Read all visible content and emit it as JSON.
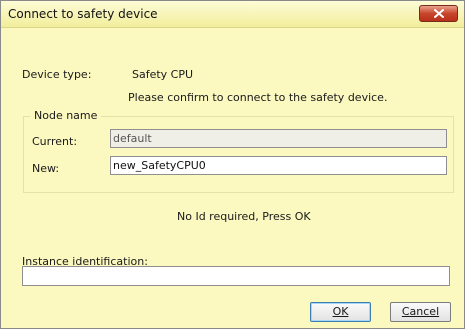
{
  "window": {
    "title": "Connect to safety device"
  },
  "device": {
    "type_label": "Device type:",
    "type_value": "Safety CPU",
    "confirm_message": "Please confirm to connect to the safety device."
  },
  "node_name": {
    "legend": "Node name",
    "current_label": "Current:",
    "current_value": "default",
    "new_label": "New:",
    "new_value": "new_SafetyCPU0"
  },
  "status_message": "No Id required, Press OK",
  "instance": {
    "label": "Instance identification:",
    "value": ""
  },
  "buttons": {
    "ok_label": "OK",
    "cancel_label": "Cancel"
  },
  "colors": {
    "dialog_background": "#fbf8c0",
    "close_button": "#c8452b"
  },
  "icons": {
    "close": "close-icon"
  }
}
